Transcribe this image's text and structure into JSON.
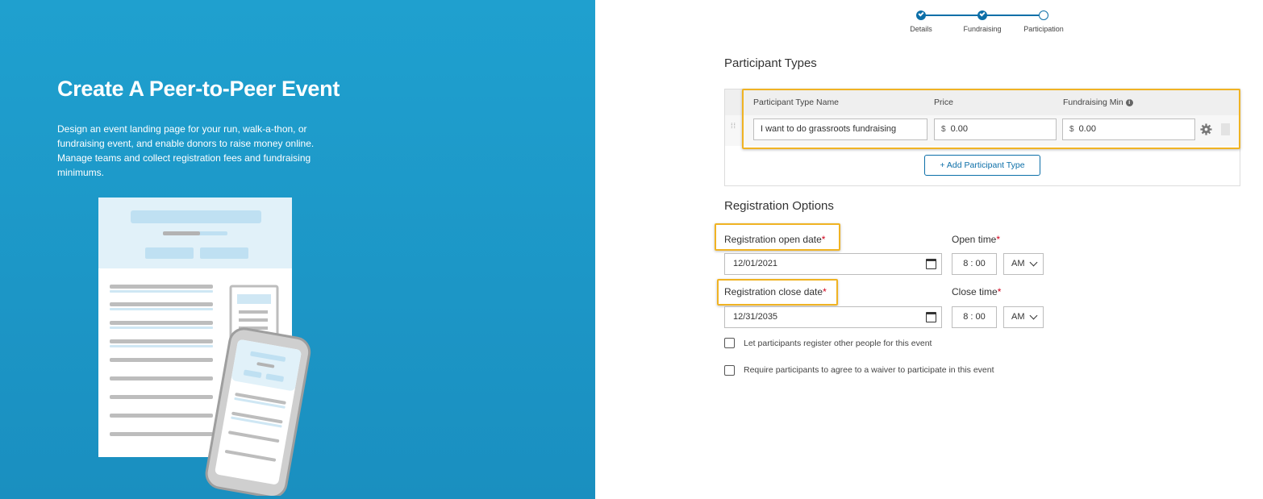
{
  "hero": {
    "title": "Create A Peer-to-Peer Event",
    "description": "Design an event landing page for your run, walk-a-thon, or fundraising event, and enable donors to raise money online. Manage teams and collect registration fees and fundraising minimums."
  },
  "stepper": {
    "steps": [
      {
        "label": "Details",
        "status": "complete"
      },
      {
        "label": "Fundraising",
        "status": "complete"
      },
      {
        "label": "Participation",
        "status": "current"
      }
    ]
  },
  "participant_types": {
    "title": "Participant Types",
    "columns": {
      "name": "Participant Type Name",
      "price": "Price",
      "fundraising_min": "Fundraising Min"
    },
    "rows": [
      {
        "name": "I want to do grassroots fundraising",
        "currency": "$",
        "price": "0.00",
        "fundraising_min": "0.00"
      }
    ],
    "add_button": "+ Add Participant Type"
  },
  "registration": {
    "title": "Registration Options",
    "open_date_label": "Registration open date",
    "open_date_value": "12/01/2021",
    "open_time_label": "Open time",
    "open_time": {
      "hour": "8",
      "sep": ":",
      "minute": "00",
      "ampm": "AM"
    },
    "close_date_label": "Registration close date",
    "close_date_value": "12/31/2035",
    "close_time_label": "Close time",
    "close_time": {
      "hour": "8",
      "sep": ":",
      "minute": "00",
      "ampm": "AM"
    },
    "required_mark": "*",
    "checkboxes": [
      {
        "label": "Let participants register other people for this event",
        "checked": false
      },
      {
        "label": "Require participants to agree to a waiver to participate in this event",
        "checked": false
      }
    ]
  },
  "colors": {
    "hero_bg": "#1a8fc0",
    "accent": "#0c6fa8",
    "highlight": "#f0b323",
    "required": "#d0021b"
  }
}
